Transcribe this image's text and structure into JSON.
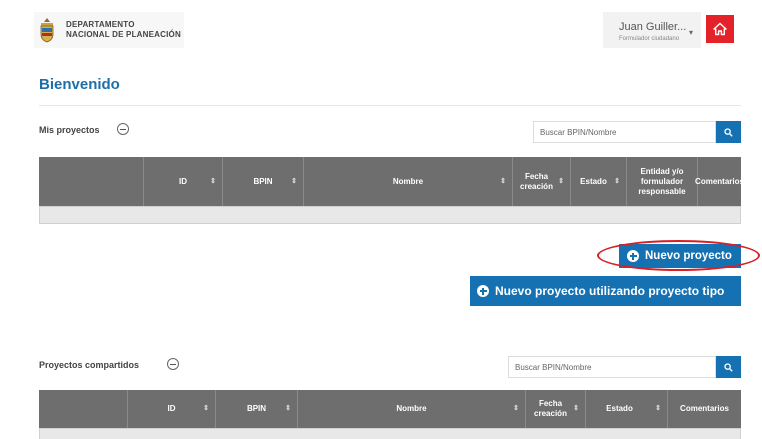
{
  "header": {
    "logo_line1": "DEPARTAMENTO",
    "logo_line2": "NACIONAL DE PLANEACIÓN",
    "user_name": "Juan Guiller...",
    "user_role": "Formulador ciudadano"
  },
  "page_title": "Bienvenido",
  "mis_proyectos": {
    "title": "Mis proyectos",
    "search_placeholder": "Buscar BPIN/Nombre",
    "columns": [
      {
        "label": "",
        "sortable": false
      },
      {
        "label": "ID",
        "sortable": true
      },
      {
        "label": "BPIN",
        "sortable": true
      },
      {
        "label": "Nombre",
        "sortable": true
      },
      {
        "label": "Fecha creación",
        "sortable": true
      },
      {
        "label": "Estado",
        "sortable": true
      },
      {
        "label": "Entidad y/o formulador responsable",
        "sortable": false
      },
      {
        "label": "Comentarios",
        "sortable": false
      }
    ]
  },
  "buttons": {
    "nuevo_proyecto": "Nuevo proyecto",
    "nuevo_proyecto_tipo": "Nuevo proyecto utilizando proyecto tipo"
  },
  "proyectos_compartidos": {
    "title": "Proyectos compartidos",
    "search_placeholder": "Buscar BPIN/Nombre",
    "columns": [
      {
        "label": "",
        "sortable": false
      },
      {
        "label": "ID",
        "sortable": true
      },
      {
        "label": "BPIN",
        "sortable": true
      },
      {
        "label": "Nombre",
        "sortable": true
      },
      {
        "label": "Fecha creación",
        "sortable": true
      },
      {
        "label": "Estado",
        "sortable": true
      },
      {
        "label": "Comentarios",
        "sortable": false
      }
    ]
  },
  "colors": {
    "accent_blue": "#1671b3",
    "title_blue": "#1d6fa8",
    "home_red": "#e4222a",
    "highlight_red": "#d81f26",
    "table_header": "#6e6e6e"
  }
}
